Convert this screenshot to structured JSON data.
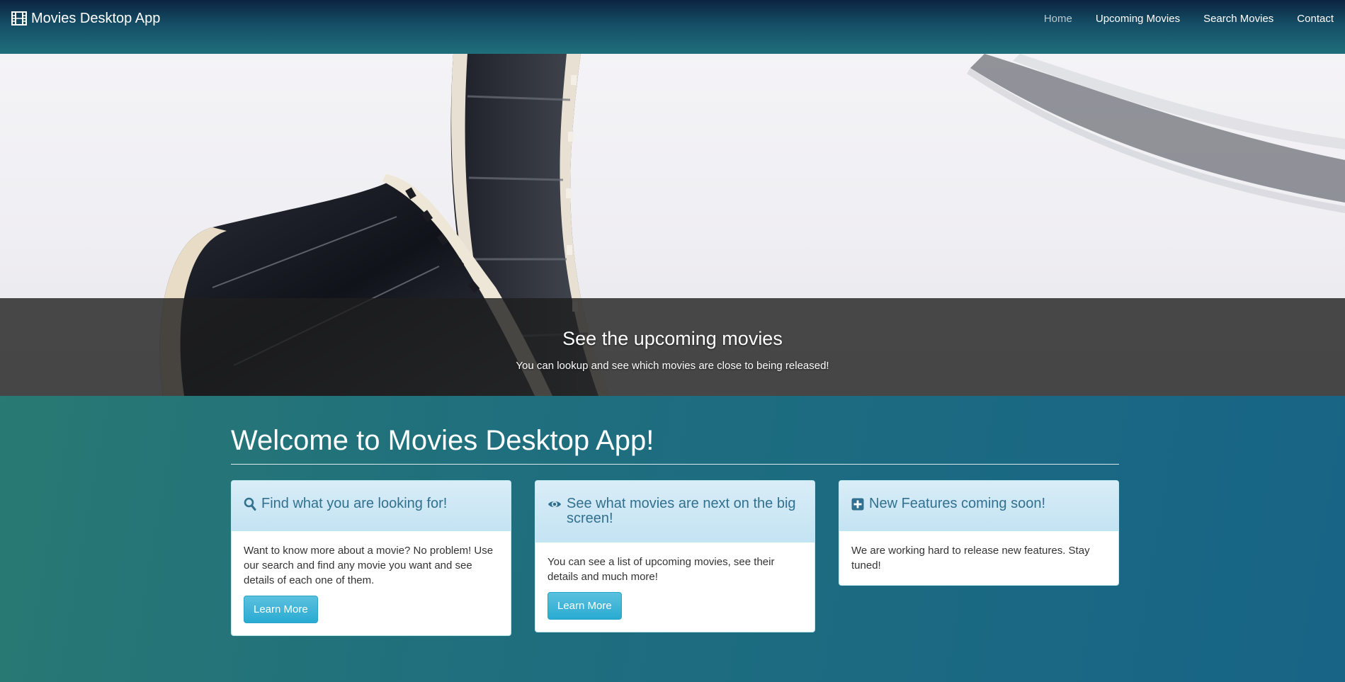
{
  "navbar": {
    "brand": "Movies Desktop App",
    "brand_icon": "film-icon",
    "links": [
      {
        "label": "Home",
        "active": true
      },
      {
        "label": "Upcoming Movies",
        "active": false
      },
      {
        "label": "Search Movies",
        "active": false
      },
      {
        "label": "Contact",
        "active": false
      }
    ]
  },
  "hero": {
    "title": "See the upcoming movies",
    "text": "You can lookup and see which movies are close to being released!"
  },
  "main": {
    "heading": "Welcome to Movies Desktop App!",
    "cards": [
      {
        "icon": "search-icon",
        "title": "Find what you are looking for!",
        "body": "Want to know more about a movie? No problem! Use our search and find any movie you want and see details of each one of them.",
        "button": "Learn More"
      },
      {
        "icon": "eye-icon",
        "title": "See what movies are next on the big screen!",
        "body": "You can see a list of upcoming movies, see their details and much more!",
        "button": "Learn More"
      },
      {
        "icon": "plus-square-icon",
        "title": "New Features coming soon!",
        "body": "We are working hard to release new features. Stay tuned!"
      }
    ]
  },
  "colors": {
    "accent": "#31708f",
    "button": "#2aabd2",
    "card_header": "#d9edf7"
  }
}
